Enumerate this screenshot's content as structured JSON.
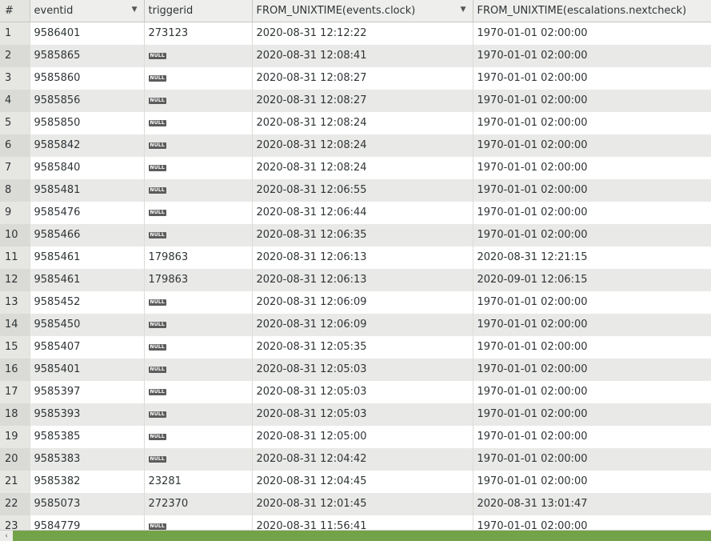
{
  "columns": [
    {
      "label": "#",
      "sortable": false
    },
    {
      "label": "eventid",
      "sort_icon": "sort-desc-icon"
    },
    {
      "label": "triggerid"
    },
    {
      "label": "FROM_UNIXTIME(events.clock)",
      "sort_icon": "sort-desc-icon"
    },
    {
      "label": "FROM_UNIXTIME(escalations.nextcheck)"
    }
  ],
  "null_label": "NULL",
  "rows": [
    {
      "n": "1",
      "eventid": "9586401",
      "triggerid": "273123",
      "clock": "2020-08-31 12:12:22",
      "nextcheck": "1970-01-01 02:00:00"
    },
    {
      "n": "2",
      "eventid": "9585865",
      "triggerid": null,
      "clock": "2020-08-31 12:08:41",
      "nextcheck": "1970-01-01 02:00:00"
    },
    {
      "n": "3",
      "eventid": "9585860",
      "triggerid": null,
      "clock": "2020-08-31 12:08:27",
      "nextcheck": "1970-01-01 02:00:00"
    },
    {
      "n": "4",
      "eventid": "9585856",
      "triggerid": null,
      "clock": "2020-08-31 12:08:27",
      "nextcheck": "1970-01-01 02:00:00"
    },
    {
      "n": "5",
      "eventid": "9585850",
      "triggerid": null,
      "clock": "2020-08-31 12:08:24",
      "nextcheck": "1970-01-01 02:00:00"
    },
    {
      "n": "6",
      "eventid": "9585842",
      "triggerid": null,
      "clock": "2020-08-31 12:08:24",
      "nextcheck": "1970-01-01 02:00:00"
    },
    {
      "n": "7",
      "eventid": "9585840",
      "triggerid": null,
      "clock": "2020-08-31 12:08:24",
      "nextcheck": "1970-01-01 02:00:00"
    },
    {
      "n": "8",
      "eventid": "9585481",
      "triggerid": null,
      "clock": "2020-08-31 12:06:55",
      "nextcheck": "1970-01-01 02:00:00"
    },
    {
      "n": "9",
      "eventid": "9585476",
      "triggerid": null,
      "clock": "2020-08-31 12:06:44",
      "nextcheck": "1970-01-01 02:00:00"
    },
    {
      "n": "10",
      "eventid": "9585466",
      "triggerid": null,
      "clock": "2020-08-31 12:06:35",
      "nextcheck": "1970-01-01 02:00:00"
    },
    {
      "n": "11",
      "eventid": "9585461",
      "triggerid": "179863",
      "clock": "2020-08-31 12:06:13",
      "nextcheck": "2020-08-31 12:21:15"
    },
    {
      "n": "12",
      "eventid": "9585461",
      "triggerid": "179863",
      "clock": "2020-08-31 12:06:13",
      "nextcheck": "2020-09-01 12:06:15"
    },
    {
      "n": "13",
      "eventid": "9585452",
      "triggerid": null,
      "clock": "2020-08-31 12:06:09",
      "nextcheck": "1970-01-01 02:00:00"
    },
    {
      "n": "14",
      "eventid": "9585450",
      "triggerid": null,
      "clock": "2020-08-31 12:06:09",
      "nextcheck": "1970-01-01 02:00:00"
    },
    {
      "n": "15",
      "eventid": "9585407",
      "triggerid": null,
      "clock": "2020-08-31 12:05:35",
      "nextcheck": "1970-01-01 02:00:00"
    },
    {
      "n": "16",
      "eventid": "9585401",
      "triggerid": null,
      "clock": "2020-08-31 12:05:03",
      "nextcheck": "1970-01-01 02:00:00"
    },
    {
      "n": "17",
      "eventid": "9585397",
      "triggerid": null,
      "clock": "2020-08-31 12:05:03",
      "nextcheck": "1970-01-01 02:00:00"
    },
    {
      "n": "18",
      "eventid": "9585393",
      "triggerid": null,
      "clock": "2020-08-31 12:05:03",
      "nextcheck": "1970-01-01 02:00:00"
    },
    {
      "n": "19",
      "eventid": "9585385",
      "triggerid": null,
      "clock": "2020-08-31 12:05:00",
      "nextcheck": "1970-01-01 02:00:00"
    },
    {
      "n": "20",
      "eventid": "9585383",
      "triggerid": null,
      "clock": "2020-08-31 12:04:42",
      "nextcheck": "1970-01-01 02:00:00"
    },
    {
      "n": "21",
      "eventid": "9585382",
      "triggerid": "23281",
      "clock": "2020-08-31 12:04:45",
      "nextcheck": "1970-01-01 02:00:00"
    },
    {
      "n": "22",
      "eventid": "9585073",
      "triggerid": "272370",
      "clock": "2020-08-31 12:01:45",
      "nextcheck": "2020-08-31 13:01:47"
    },
    {
      "n": "23",
      "eventid": "9584779",
      "triggerid": null,
      "clock": "2020-08-31 11:56:41",
      "nextcheck": "1970-01-01 02:00:00"
    }
  ],
  "scrollbar": {
    "left_arrow_icon": "chevron-left-icon",
    "left_arrow_glyph": "‹"
  },
  "sort_glyph": "▼",
  "colors": {
    "scrollbar_thumb": "#73a349",
    "null_badge": "#5c5c5c"
  }
}
